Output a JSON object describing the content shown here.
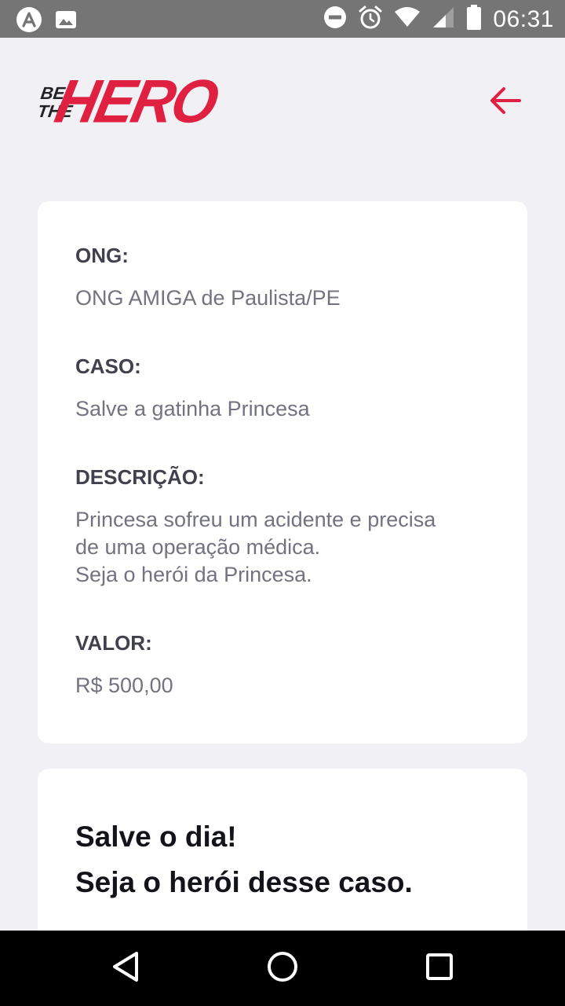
{
  "status_bar": {
    "time": "06:31",
    "left_icons": [
      "app-logo-icon",
      "image-icon"
    ],
    "right_icons": [
      "do-not-disturb-icon",
      "alarm-icon",
      "wifi-icon",
      "signal-icon",
      "battery-icon"
    ]
  },
  "header": {
    "logo": {
      "line1": "BE",
      "line2": "THE",
      "word": "HERO"
    },
    "back_icon": "arrow-left-icon"
  },
  "incident": {
    "ong_label": "ONG:",
    "ong_value": "ONG AMIGA de Paulista/PE",
    "case_label": "CASO:",
    "case_value": "Salve a gatinha Princesa",
    "description_label": "DESCRIÇÃO:",
    "description_value": "Princesa sofreu um acidente e precisa\nde uma operação médica.\nSeja o herói da Princesa.",
    "value_label": "VALOR:",
    "value_value": "R$ 500,00"
  },
  "contact": {
    "title_line1": "Salve o dia!",
    "title_line2": "Seja o herói desse caso."
  },
  "colors": {
    "primary": "#e02041",
    "background": "#f0f0f5",
    "label": "#41414d",
    "value": "#737380",
    "title": "#13131a"
  },
  "nav_bar": {
    "icons": [
      "back-triangle-icon",
      "home-circle-icon",
      "recents-square-icon"
    ]
  }
}
